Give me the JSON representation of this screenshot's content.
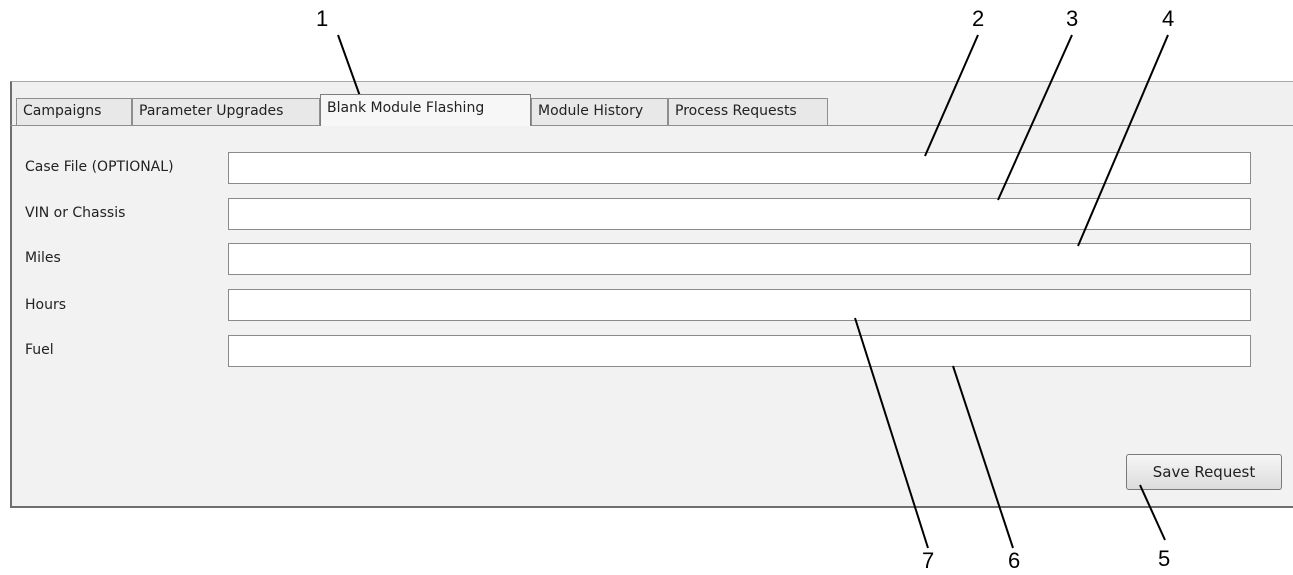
{
  "tabs": [
    {
      "label": "Campaigns",
      "active": false
    },
    {
      "label": "Parameter Upgrades",
      "active": false
    },
    {
      "label": "Blank Module Flashing",
      "active": true
    },
    {
      "label": "Module History",
      "active": false
    },
    {
      "label": "Process Requests",
      "active": false
    }
  ],
  "form": {
    "fields": [
      {
        "label": "Case File (OPTIONAL)",
        "value": ""
      },
      {
        "label": "VIN or Chassis",
        "value": ""
      },
      {
        "label": "Miles",
        "value": ""
      },
      {
        "label": "Hours",
        "value": ""
      },
      {
        "label": "Fuel",
        "value": ""
      }
    ],
    "save_label": "Save Request"
  },
  "callouts": [
    "1",
    "2",
    "3",
    "4",
    "5",
    "6",
    "7"
  ]
}
